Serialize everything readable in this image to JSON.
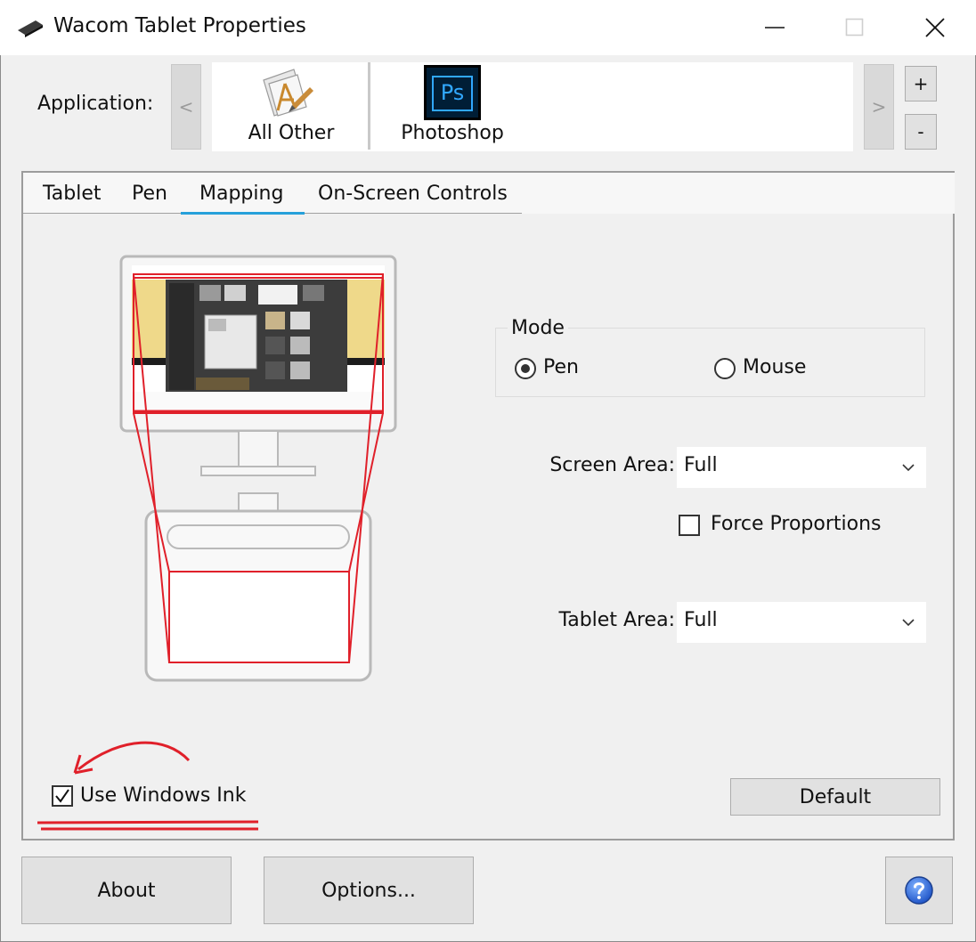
{
  "window": {
    "title": "Wacom Tablet Properties"
  },
  "application": {
    "label": "Application:",
    "prev_arrow": "<",
    "next_arrow": ">",
    "items": [
      {
        "label": "All Other",
        "icon": "all-other-app-icon"
      },
      {
        "label": "Photoshop",
        "icon": "photoshop-icon",
        "icon_text": "Ps"
      }
    ],
    "add_label": "+",
    "remove_label": "-"
  },
  "tabs": [
    {
      "label": "Tablet",
      "selected": false
    },
    {
      "label": "Pen",
      "selected": false
    },
    {
      "label": "Mapping",
      "selected": true
    },
    {
      "label": "On-Screen Controls",
      "selected": false
    }
  ],
  "mapping": {
    "mode": {
      "legend": "Mode",
      "options": [
        {
          "label": "Pen",
          "checked": true
        },
        {
          "label": "Mouse",
          "checked": false
        }
      ]
    },
    "screen_area": {
      "label": "Screen Area:",
      "value": "Full"
    },
    "force_proportions": {
      "label": "Force Proportions",
      "checked": false
    },
    "tablet_area": {
      "label": "Tablet Area:",
      "value": "Full"
    },
    "use_windows_ink": {
      "label": "Use Windows Ink",
      "checked": true
    },
    "default_label": "Default"
  },
  "footer": {
    "about_label": "About",
    "options_label": "Options...",
    "help_icon": "help-icon"
  },
  "colors": {
    "accent_tab": "#26a0da",
    "mapping_lines": "#e0202a",
    "annotation": "#e0202a",
    "photoshop_bg": "#001e36",
    "photoshop_fg": "#31a8ff"
  }
}
